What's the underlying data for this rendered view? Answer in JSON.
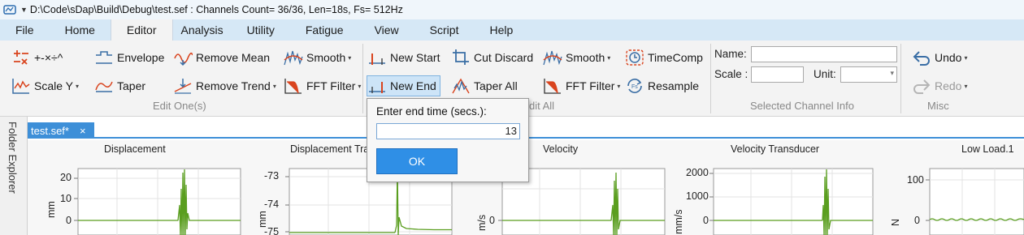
{
  "window": {
    "title": "D:\\Code\\sDap\\Build\\Debug\\test.sef : Channels Count= 36/36, Len=18s, Fs= 512Hz"
  },
  "menu": [
    "File",
    "Home",
    "Editor",
    "Analysis",
    "Utility",
    "Fatigue",
    "View",
    "Script",
    "Help"
  ],
  "ribbon": {
    "edit_one": {
      "math": "+-×÷^",
      "envelope": "Envelope",
      "remove_mean": "Remove Mean",
      "smooth": "Smooth",
      "scale_y": "Scale Y",
      "taper": "Taper",
      "remove_trend": "Remove Trend",
      "fft_filter": "FFT Filter",
      "label": "Edit One(s)"
    },
    "edit_all": {
      "new_start": "New Start",
      "cut_discard": "Cut Discard",
      "smooth": "Smooth",
      "timecomp": "TimeComp",
      "new_end": "New End",
      "taper_all": "Taper All",
      "fft_filter": "FFT Filter",
      "resample": "Resample",
      "label_visible": "dit All"
    },
    "channel_info": {
      "name_label": "Name:",
      "name_value": "",
      "scale_label": "Scale :",
      "scale_value": "",
      "unit_label": "Unit:",
      "unit_value": "",
      "label": "Selected Channel Info"
    },
    "misc": {
      "undo": "Undo",
      "redo": "Redo",
      "label": "Misc"
    }
  },
  "sidebar": {
    "label": "Folder Explorer"
  },
  "doc_tab": {
    "label": "test.sef*",
    "close": "×"
  },
  "popup": {
    "prompt": "Enter end time (secs.):",
    "value": "13",
    "ok": "OK"
  },
  "plots": [
    {
      "title": "Displacement",
      "unit": "mm",
      "ticks": [
        "20",
        "10",
        "0"
      ]
    },
    {
      "title": "Displacement Tra",
      "unit": "mm",
      "ticks": [
        "-73",
        "-74",
        "-75"
      ]
    },
    {
      "title": "Velocity",
      "unit": "m/s",
      "ticks": [
        "0"
      ]
    },
    {
      "title": "Velocity Transducer",
      "unit": "mm/s",
      "ticks": [
        "2000",
        "1000",
        "0"
      ]
    },
    {
      "title": "Low Load.1",
      "unit": "N",
      "ticks": [
        "100",
        "0"
      ]
    }
  ],
  "colors": {
    "accent": "#3d8fd8",
    "trace": "#5a9e1f",
    "menubar": "#d6e8f6",
    "ribbon": "#f3f3f3"
  }
}
